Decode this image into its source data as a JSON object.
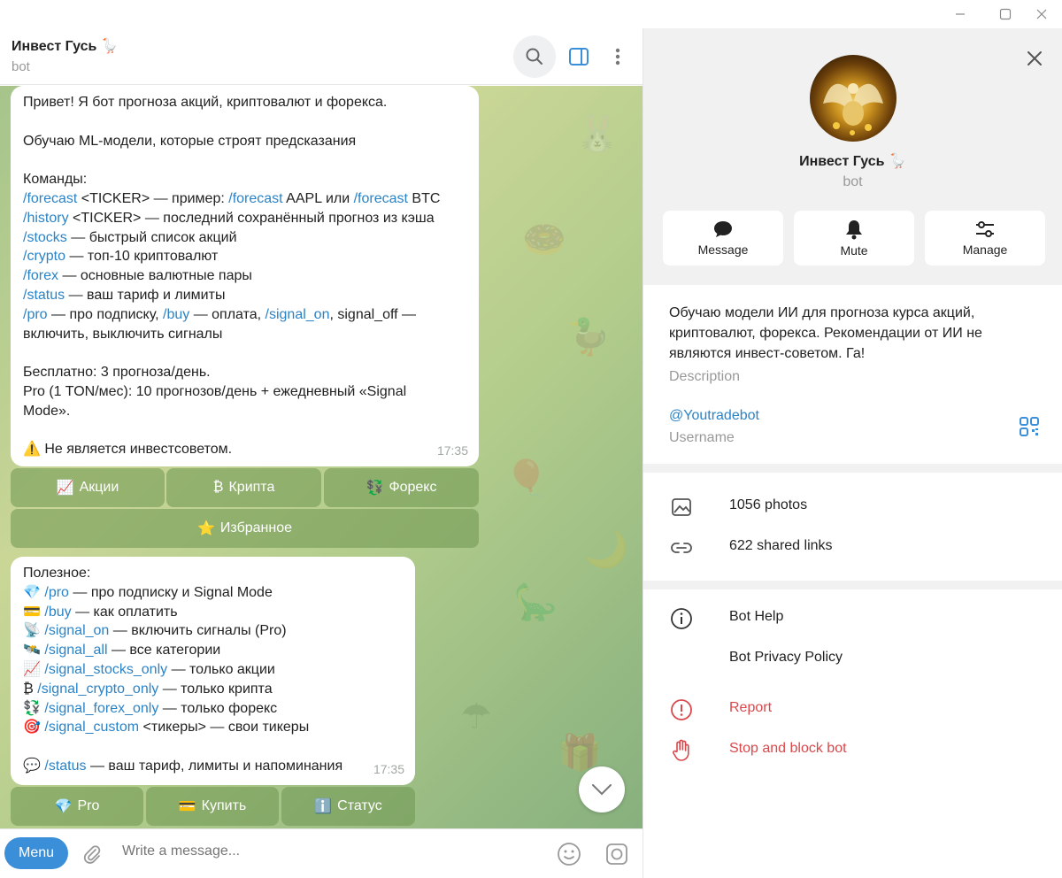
{
  "window": {
    "minimize": "—",
    "maximize": "☐",
    "close": "✕"
  },
  "chat": {
    "title": "Инвест Гусь 🪿",
    "subtitle": "bot",
    "welcome": {
      "l1": "Привет! Я бот прогноза акций, криптовалют и форекса.",
      "l2": "Обучаю ML-модели, которые строят предсказания",
      "l3": "Команды:",
      "c_forecast": "/forecast",
      "t_forecast": " <TICKER> — пример: ",
      "c_forecast2": "/forecast",
      "t_forecast2": " AAPL или ",
      "c_forecast3": "/forecast",
      "t_forecast3": " BTC",
      "c_history": "/history",
      "t_history": " <TICKER> — последний сохранённый прогноз из кэша",
      "c_stocks": "/stocks",
      "t_stocks": " — быстрый список акций",
      "c_crypto": "/crypto",
      "t_crypto": " — топ-10 криптовалют",
      "c_forex": "/forex",
      "t_forex": " — основные валютные пары",
      "c_status": "/status",
      "t_status": " — ваш тариф и лимиты",
      "c_pro": "/pro",
      "t_pro": " — про подписку, ",
      "c_buy": "/buy",
      "t_buy": " — оплата, ",
      "c_signal_on": "/signal_on",
      "t_signal_on": ", signal_off —",
      "l_enable": "включить, выключить сигналы",
      "l_free": "Бесплатно: 3 прогноза/день.",
      "l_pro1": "Pro (1 TON/мес): 10 прогнозов/день + ежедневный «Signal",
      "l_pro2": "Mode».",
      "l_warn": "⚠️ Не является инвестсоветом.",
      "time": "17:35"
    },
    "keyboard1": [
      {
        "icon": "📈",
        "label": "Акции"
      },
      {
        "icon": "₿",
        "label": "Крипта"
      },
      {
        "icon": "💱",
        "label": "Форекс"
      },
      {
        "icon": "⭐",
        "label": "Избранное"
      }
    ],
    "useful": {
      "title": "Полезное:",
      "items": [
        {
          "icon": "💎",
          "cmd": "/pro",
          "text": " — про подписку и Signal Mode"
        },
        {
          "icon": "💳",
          "cmd": "/buy",
          "text": " — как оплатить"
        },
        {
          "icon": "📡",
          "cmd": "/signal_on",
          "text": " — включить сигналы (Pro)"
        },
        {
          "icon": "🛰️",
          "cmd": "/signal_all",
          "text": " — все категории"
        },
        {
          "icon": "📈",
          "cmd": "/signal_stocks_only",
          "text": " — только акции"
        },
        {
          "icon": "₿",
          "cmd": "/signal_crypto_only",
          "text": " — только крипта"
        },
        {
          "icon": "💱",
          "cmd": "/signal_forex_only",
          "text": " — только форекс"
        },
        {
          "icon": "🎯",
          "cmd": "/signal_custom",
          "text": " <тикеры> — свои тикеры"
        }
      ],
      "status_icon": "💬",
      "status_cmd": "/status",
      "status_text": " — ваш тариф, лимиты и напоминания",
      "time": "17:35"
    },
    "keyboard2": [
      {
        "icon": "💎",
        "label": "Pro"
      },
      {
        "icon": "💳",
        "label": "Купить"
      },
      {
        "icon": "ℹ️",
        "label": "Статус"
      }
    ]
  },
  "composer": {
    "menu": "Menu",
    "placeholder": "Write a message..."
  },
  "profile": {
    "name": "Инвест Гусь 🪿",
    "sub": "bot",
    "actions": [
      {
        "icon": "message-icon",
        "label": "Message"
      },
      {
        "icon": "bell-icon",
        "label": "Mute"
      },
      {
        "icon": "sliders-icon",
        "label": "Manage"
      }
    ],
    "description": "Обучаю модели ИИ для прогноза курса акций, криптовалют, форекса. Рекомендации от ИИ не являются инвест-советом. Га!",
    "description_label": "Description",
    "username": "@Youtradebot",
    "username_label": "Username",
    "media": [
      {
        "icon": "photo-icon",
        "label": "1056 photos"
      },
      {
        "icon": "link-icon",
        "label": "622 shared links"
      }
    ],
    "links": [
      {
        "icon": "info-icon",
        "label": "Bot Help"
      },
      {
        "icon": "",
        "label": "Bot Privacy Policy"
      },
      {
        "icon": "report-icon",
        "label": "Report"
      },
      {
        "icon": "hand-icon",
        "label": "Stop and block bot"
      }
    ],
    "colors": {
      "accent": "#3a8fd8",
      "link": "#2b83c6",
      "danger": "#d9484b"
    }
  }
}
